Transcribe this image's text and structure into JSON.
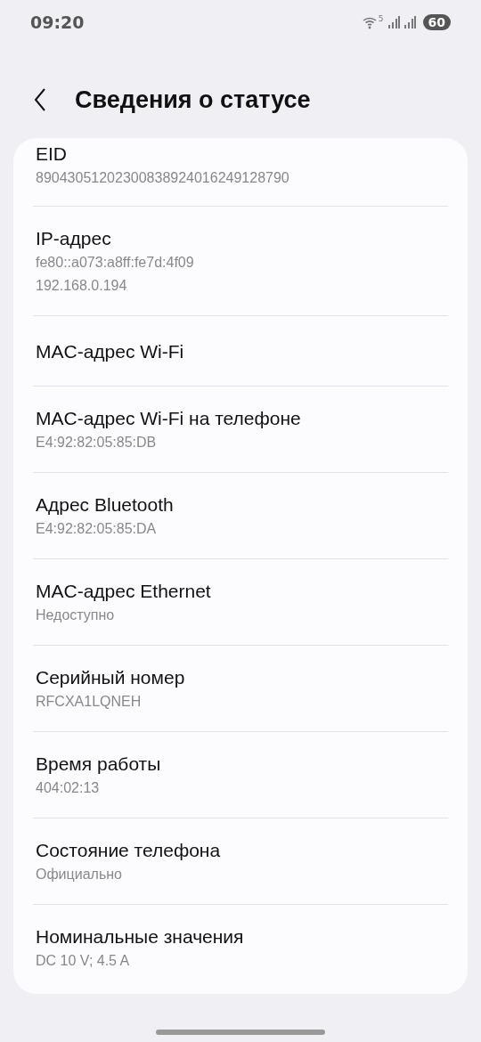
{
  "status_bar": {
    "time": "09:20",
    "wifi_band": "5",
    "battery": "60"
  },
  "header": {
    "title": "Сведения о статусе"
  },
  "items": [
    {
      "title": "EID",
      "values": [
        "89043051202300838924016249128790"
      ]
    },
    {
      "title": "IP-адрес",
      "values": [
        "fe80::a073:a8ff:fe7d:4f09",
        "192.168.0.194"
      ]
    },
    {
      "title": "MAC-адрес Wi-Fi"
    },
    {
      "title": "MAC-адрес Wi-Fi на телефоне",
      "values": [
        "E4:92:82:05:85:DB"
      ]
    },
    {
      "title": "Адрес Bluetooth",
      "values": [
        "E4:92:82:05:85:DA"
      ]
    },
    {
      "title": "MAC-адрес Ethernet",
      "values": [
        "Недоступно"
      ]
    },
    {
      "title": "Серийный номер",
      "values": [
        "RFCXA1LQNEH"
      ]
    },
    {
      "title": "Время работы",
      "values": [
        "404:02:13"
      ]
    },
    {
      "title": "Состояние телефона",
      "values": [
        "Официально"
      ]
    },
    {
      "title": "Номинальные значения",
      "values": [
        "DC 10 V; 4.5 A"
      ]
    }
  ]
}
